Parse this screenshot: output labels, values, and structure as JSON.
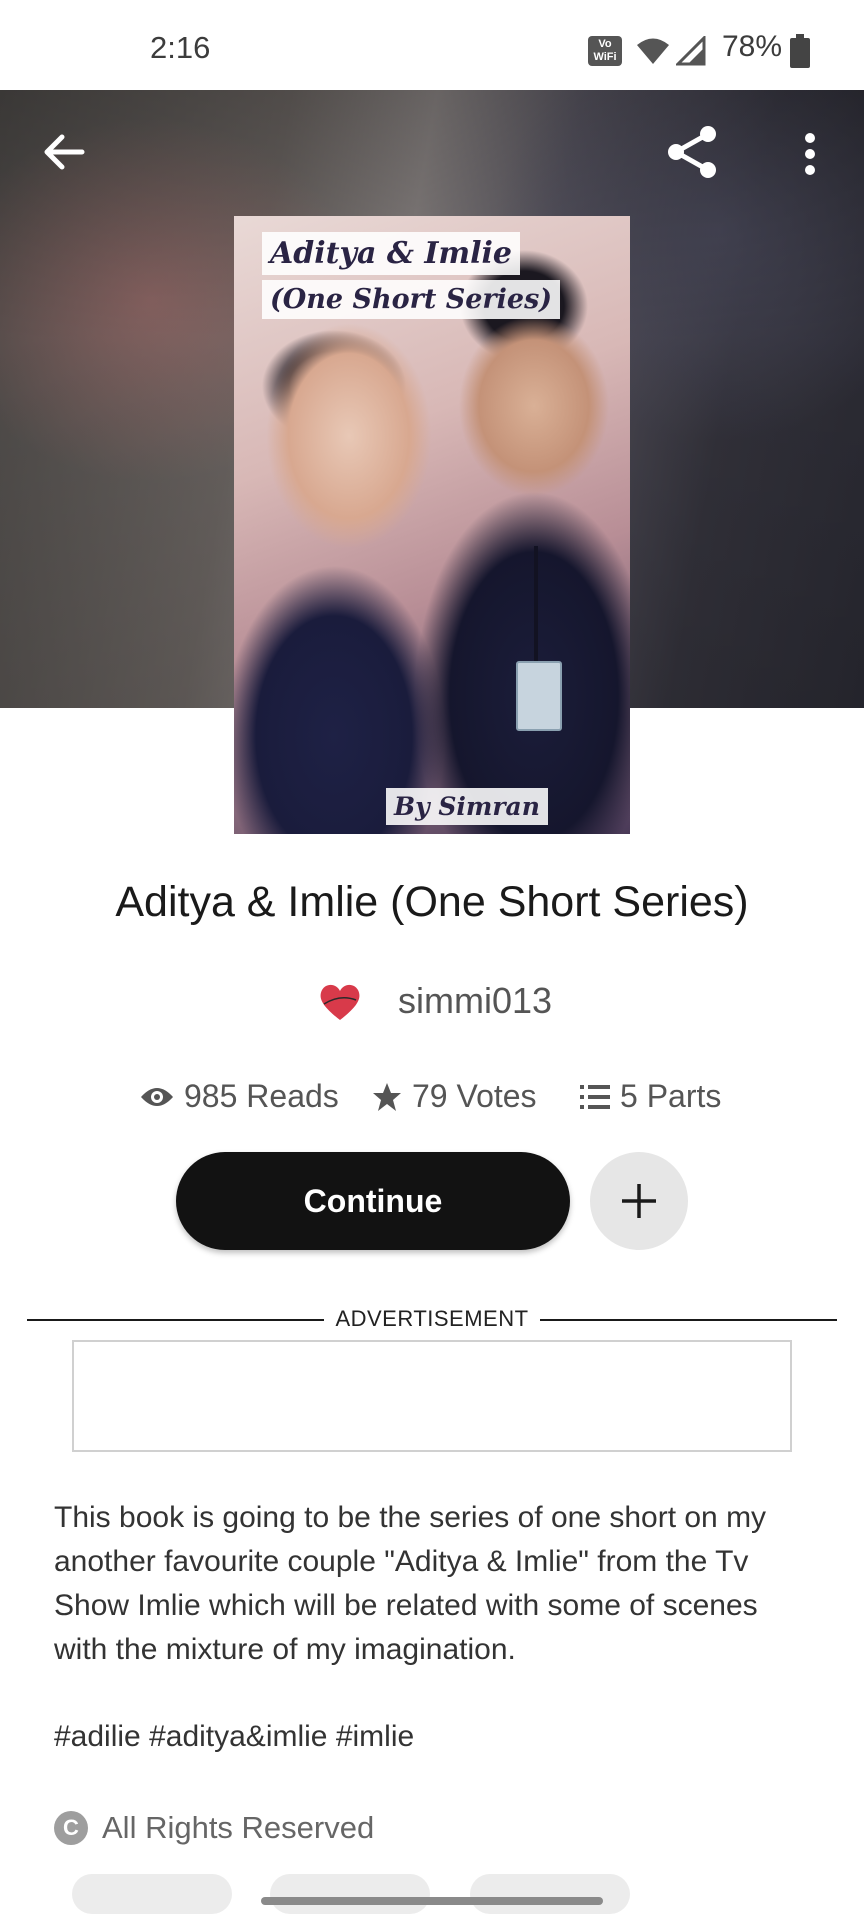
{
  "status_bar": {
    "time": "2:16",
    "volte": "Vo\nWiFi",
    "battery": "78%"
  },
  "toolbar": {
    "back_icon": "arrow-left-icon",
    "share_icon": "share-icon",
    "more_icon": "more-vertical-icon"
  },
  "cover": {
    "title_line1": "Aditya & Imlie",
    "title_line2": "(One Short Series)",
    "byline": "By Simran"
  },
  "story": {
    "title": "Aditya & Imlie (One Short Series)",
    "author": "simmi013",
    "stats": {
      "reads": "985 Reads",
      "votes": "79 Votes",
      "parts": "5 Parts"
    },
    "continue_label": "Continue",
    "description": "This book is going to be the series of one short on my another favourite couple \"Aditya & Imlie\" from the Tv Show Imlie which will be related with some of scenes with the mixture of my imagination.",
    "tags": "#adilie #aditya&imlie #imlie",
    "rights": "All Rights Reserved",
    "rights_icon": "C"
  },
  "ad": {
    "label": "ADVERTISEMENT"
  },
  "colors": {
    "button": "#121212",
    "add_button": "#e6e6e6",
    "text": "#1a1a1a",
    "muted": "#555555"
  }
}
